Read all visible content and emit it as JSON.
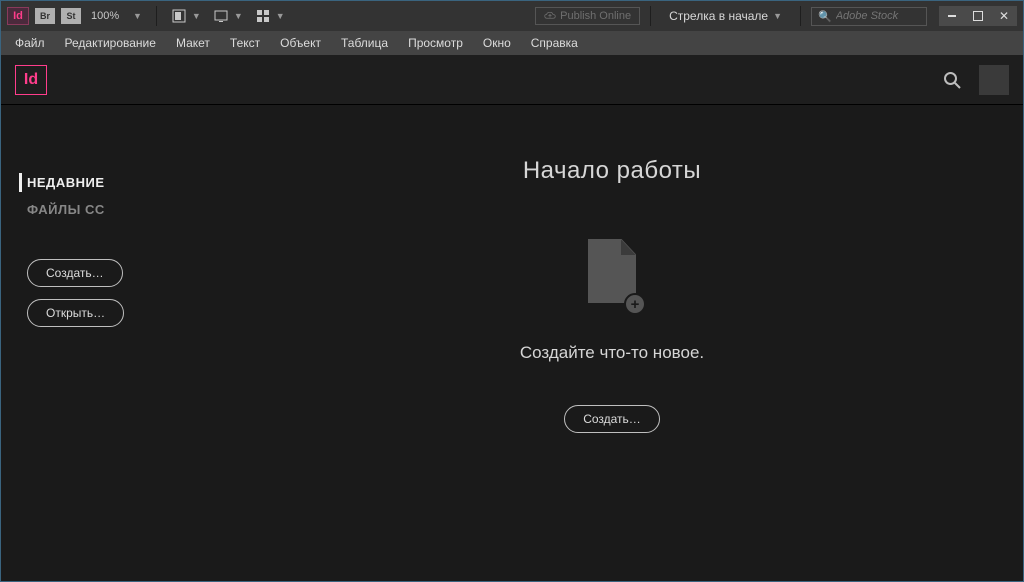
{
  "top": {
    "app_abbr": "Id",
    "br_badge": "Br",
    "st_badge": "St",
    "zoom": "100%",
    "publish_label": "Publish Online",
    "workspace_label": "Стрелка в начале",
    "stock_placeholder": "Adobe Stock"
  },
  "menu": {
    "items": [
      "Файл",
      "Редактирование",
      "Макет",
      "Текст",
      "Объект",
      "Таблица",
      "Просмотр",
      "Окно",
      "Справка"
    ]
  },
  "subheader": {
    "logo_abbr": "Id"
  },
  "sidebar": {
    "items": [
      {
        "label": "НЕДАВНИЕ",
        "active": true
      },
      {
        "label": "ФАЙЛЫ CC",
        "active": false
      }
    ],
    "create_label": "Создать…",
    "open_label": "Открыть…"
  },
  "center": {
    "title": "Начало работы",
    "subtitle": "Создайте что-то новое.",
    "create_label": "Создать…",
    "plus_glyph": "+"
  }
}
